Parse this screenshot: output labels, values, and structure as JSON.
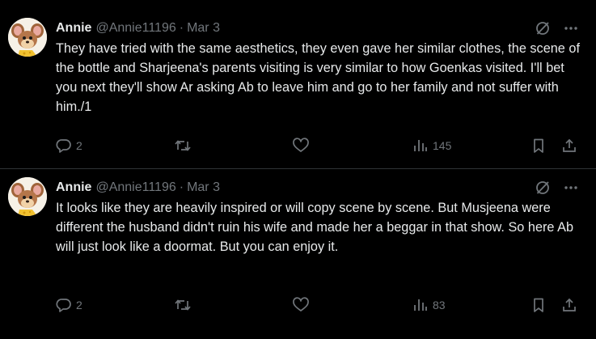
{
  "tweets": [
    {
      "author_name": "Annie",
      "author_handle": "@Annie11196",
      "separator": "·",
      "date": "Mar 3",
      "text": "They have tried with the same aesthetics, they even gave her similar clothes, the scene of the bottle and Sharjeena's parents visiting is very similar to how Goenkas visited. I'll bet you next they'll show Ar asking Ab to leave him and go to her family and not suffer with him./1",
      "reply_count": "2",
      "retweet_count": "",
      "like_count": "",
      "view_count": "145"
    },
    {
      "author_name": "Annie",
      "author_handle": "@Annie11196",
      "separator": "·",
      "date": "Mar 3",
      "text": "It looks like they are heavily inspired or will copy scene by scene. But Musjeena were different the husband didn't ruin his wife and made her a beggar in that show. So here Ab will just look like a doormat. But you can enjoy it.",
      "reply_count": "2",
      "retweet_count": "",
      "like_count": "",
      "view_count": "83"
    }
  ],
  "icons": {
    "avatar": "cartoon-mouse-avatar",
    "grok": "grok-icon",
    "more": "more-icon",
    "reply": "reply-icon",
    "retweet": "retweet-icon",
    "like": "like-icon",
    "views": "views-icon",
    "bookmark": "bookmark-icon",
    "share": "share-icon"
  },
  "colors": {
    "background": "#000000",
    "text_primary": "#e7e9ea",
    "text_secondary": "#71767b",
    "divider": "#2f3336"
  }
}
